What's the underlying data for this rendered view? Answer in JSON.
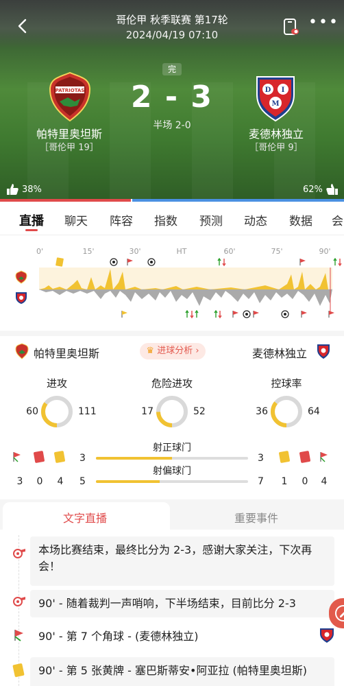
{
  "header": {
    "league_round": "哥伦甲 秋季联赛 第17轮",
    "datetime": "2024/04/19 07:10",
    "status": "完",
    "score": "2 - 3",
    "halftime": "半场 2-0",
    "home": {
      "name": "帕特里奥坦斯",
      "rank": "［哥伦甲 19］",
      "vote": "38%"
    },
    "away": {
      "name": "麦德林独立",
      "rank": "［哥伦甲 9］",
      "vote": "62%"
    },
    "vote_home_fraction": 0.38,
    "colors": {
      "home_bar": "#e04a4a",
      "away_bar": "#4a90e2"
    }
  },
  "tabs": [
    "直播",
    "聊天",
    "阵容",
    "指数",
    "预测",
    "动态",
    "数据",
    "会"
  ],
  "timeline": {
    "labels": [
      "0'",
      "15'",
      "30'",
      "HT",
      "60'",
      "75'",
      "90'"
    ]
  },
  "stats_header": {
    "home_name": "帕特里奥坦斯",
    "away_name": "麦德林独立",
    "analysis_label": "进球分析",
    "analysis_icon": "crown-icon"
  },
  "stats": [
    {
      "title": "进攻",
      "home": "60",
      "away": "111",
      "home_value": 60,
      "away_value": 111
    },
    {
      "title": "危险进攻",
      "home": "17",
      "away": "52",
      "home_value": 17,
      "away_value": 52
    },
    {
      "title": "控球率",
      "home": "36",
      "away": "64",
      "home_value": 36,
      "away_value": 64
    }
  ],
  "compare": [
    {
      "title": "射正球门",
      "home": "3",
      "away": "3",
      "home_fraction": 0.5
    },
    {
      "title": "射偏球门",
      "home": "5",
      "away": "7",
      "home_fraction": 0.42
    }
  ],
  "cards": {
    "home": {
      "corners": "3",
      "red": "0",
      "yellow": "4"
    },
    "away": {
      "yellow": "1",
      "red": "0",
      "corners": "4"
    }
  },
  "live_tabs": {
    "text_live": "文字直播",
    "key_events": "重要事件"
  },
  "feed": [
    {
      "icon": "whistle-icon",
      "text": "本场比赛结束，最终比分为 2-3，感谢大家关注，下次再会！"
    },
    {
      "icon": "whistle-icon",
      "text": "90' - 随着裁判一声哨响，下半场结束，目前比分 2-3"
    },
    {
      "icon": "corner-flag-icon",
      "text": "90' - 第 7 个角球 - (麦德林独立)"
    },
    {
      "icon": "yellow-card-icon",
      "text": "90' - 第 5 张黄牌 - 塞巴斯蒂安•阿亚拉 (帕特里奥坦斯)"
    }
  ]
}
